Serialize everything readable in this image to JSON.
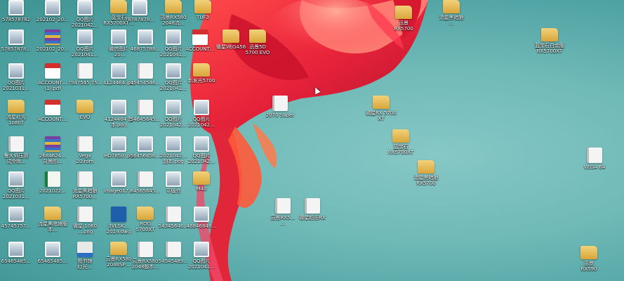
{
  "desktop": {
    "left_icons": [
      {
        "label": "578578782",
        "type": "image"
      },
      {
        "label": "202102_20…",
        "type": "image"
      },
      {
        "label": "QQ图片\n2021042…",
        "type": "image"
      },
      {
        "label": "蓝宝石\nRX5700XT…",
        "type": "folder"
      },
      {
        "label": "78787878…",
        "type": "image"
      },
      {
        "label": "迅景RX580\n2048流…",
        "type": "folder"
      },
      {
        "label": "TUF3",
        "type": "folder"
      },
      {
        "label": "57857878…",
        "type": "image"
      },
      {
        "label": "202102_20…",
        "type": "rar"
      },
      {
        "label": "QQ图片\n2021041…",
        "type": "image"
      },
      {
        "label": "微信图片\n_20…",
        "type": "image"
      },
      {
        "label": "46875788…",
        "type": "image"
      },
      {
        "label": "QQ图片\n2021041…",
        "type": "image"
      },
      {
        "label": "ACCOUNT…",
        "type": "pdf"
      },
      {
        "label": "微星VEGA56",
        "type": "folder"
      },
      {
        "label": "迅景5D\n5700 EVO",
        "type": "folder"
      },
      {
        "label": "QQ图片\n2021031…",
        "type": "image"
      },
      {
        "label": "ACCOUNT…\n(1).pdf",
        "type": "pdf"
      },
      {
        "label": "7547545 75…",
        "type": "doc"
      },
      {
        "label": "4124464.jpg",
        "type": "image"
      },
      {
        "label": "45454546…",
        "type": "doc"
      },
      {
        "label": "QQ图片\n2021041…",
        "type": "image"
      },
      {
        "label": "新发光5700",
        "type": "folder"
      },
      {
        "label": "流星红光\n1080T",
        "type": "folder"
      },
      {
        "label": "ACCOUNT…",
        "type": "pdf"
      },
      {
        "label": "EVO",
        "type": "folder"
      },
      {
        "label": "4124464 副\n本.png",
        "type": "image"
      },
      {
        "label": "54645645…",
        "type": "doc"
      },
      {
        "label": "QQ图片\n2021042…",
        "type": "image"
      },
      {
        "label": "QQ图片\n2021042…",
        "type": "image"
      },
      {
        "label": "鲁大师压测\n试令牌…",
        "type": "doc"
      },
      {
        "label": "2684624…\n背景图…",
        "type": "rar"
      },
      {
        "label": "Vega\n20.rom",
        "type": "doc"
      },
      {
        "label": "HD7850.jpg",
        "type": "image"
      },
      {
        "label": "56456456…",
        "type": "image"
      },
      {
        "label": "2021042…\n副本.png",
        "type": "image"
      },
      {
        "label": "QQ图片\n2021042…",
        "type": "image"
      },
      {
        "label": "QQ图片\n2021031…",
        "type": "image"
      },
      {
        "label": "2021022…",
        "type": "xls"
      },
      {
        "label": "流星黑暗狼\nRX5700…",
        "type": "doc"
      },
      {
        "label": "image017…",
        "type": "image"
      },
      {
        "label": "64565645…",
        "type": "doc"
      },
      {
        "label": "平版仓",
        "type": "image"
      },
      {
        "label": "M40",
        "type": "folder"
      },
      {
        "label": "45745757…",
        "type": "image"
      },
      {
        "label": "流星黑暗狼版\n本…",
        "type": "folder"
      },
      {
        "label": "微星 1060\n….png",
        "type": "doc"
      },
      {
        "label": "3VLSK…\n2019.dwg",
        "type": "dwg"
      },
      {
        "label": "ROG\n5700XT",
        "type": "folder"
      },
      {
        "label": "54345646…",
        "type": "doc"
      },
      {
        "label": "46846848…",
        "type": "image"
      },
      {
        "label": "65465485…",
        "type": "image"
      },
      {
        "label": "65465485…",
        "type": "image"
      },
      {
        "label": "图书馆\n红光…",
        "type": "exe"
      },
      {
        "label": "云景RX580\n2048SP…",
        "type": "folder"
      },
      {
        "label": "云景RX580\n2048版本…",
        "type": "doc"
      },
      {
        "label": "54545489…",
        "type": "doc"
      },
      {
        "label": "QQ图片\n2021041…",
        "type": "image"
      }
    ],
    "right_icons": [
      {
        "label": "迅景\nRX5700",
        "type": "folder"
      },
      {
        "label": "流星黑暗狼\n…",
        "type": "folder"
      },
      {
        "label": "蓝宝石白金版\nRX5700XT",
        "type": "folder"
      },
      {
        "label": "2070 Super",
        "type": "doc"
      },
      {
        "label": "微星RX 5700\nXT",
        "type": "folder"
      },
      {
        "label": "蓝宝石\nRX5700XT",
        "type": "folder"
      },
      {
        "label": "流星黑暗狼\nRX5700",
        "type": "folder"
      },
      {
        "label": "云景RX5…\n…",
        "type": "doc"
      },
      {
        "label": "微星超击RX",
        "type": "doc"
      },
      {
        "label": "VEGA 64",
        "type": "doc"
      },
      {
        "label": "迅景\nRX590",
        "type": "folder"
      }
    ],
    "colors": {
      "wallpaper_teal": "#6fb9b7",
      "flower_red": "#e8233a",
      "flower_highlight": "#ff7a6a"
    }
  }
}
